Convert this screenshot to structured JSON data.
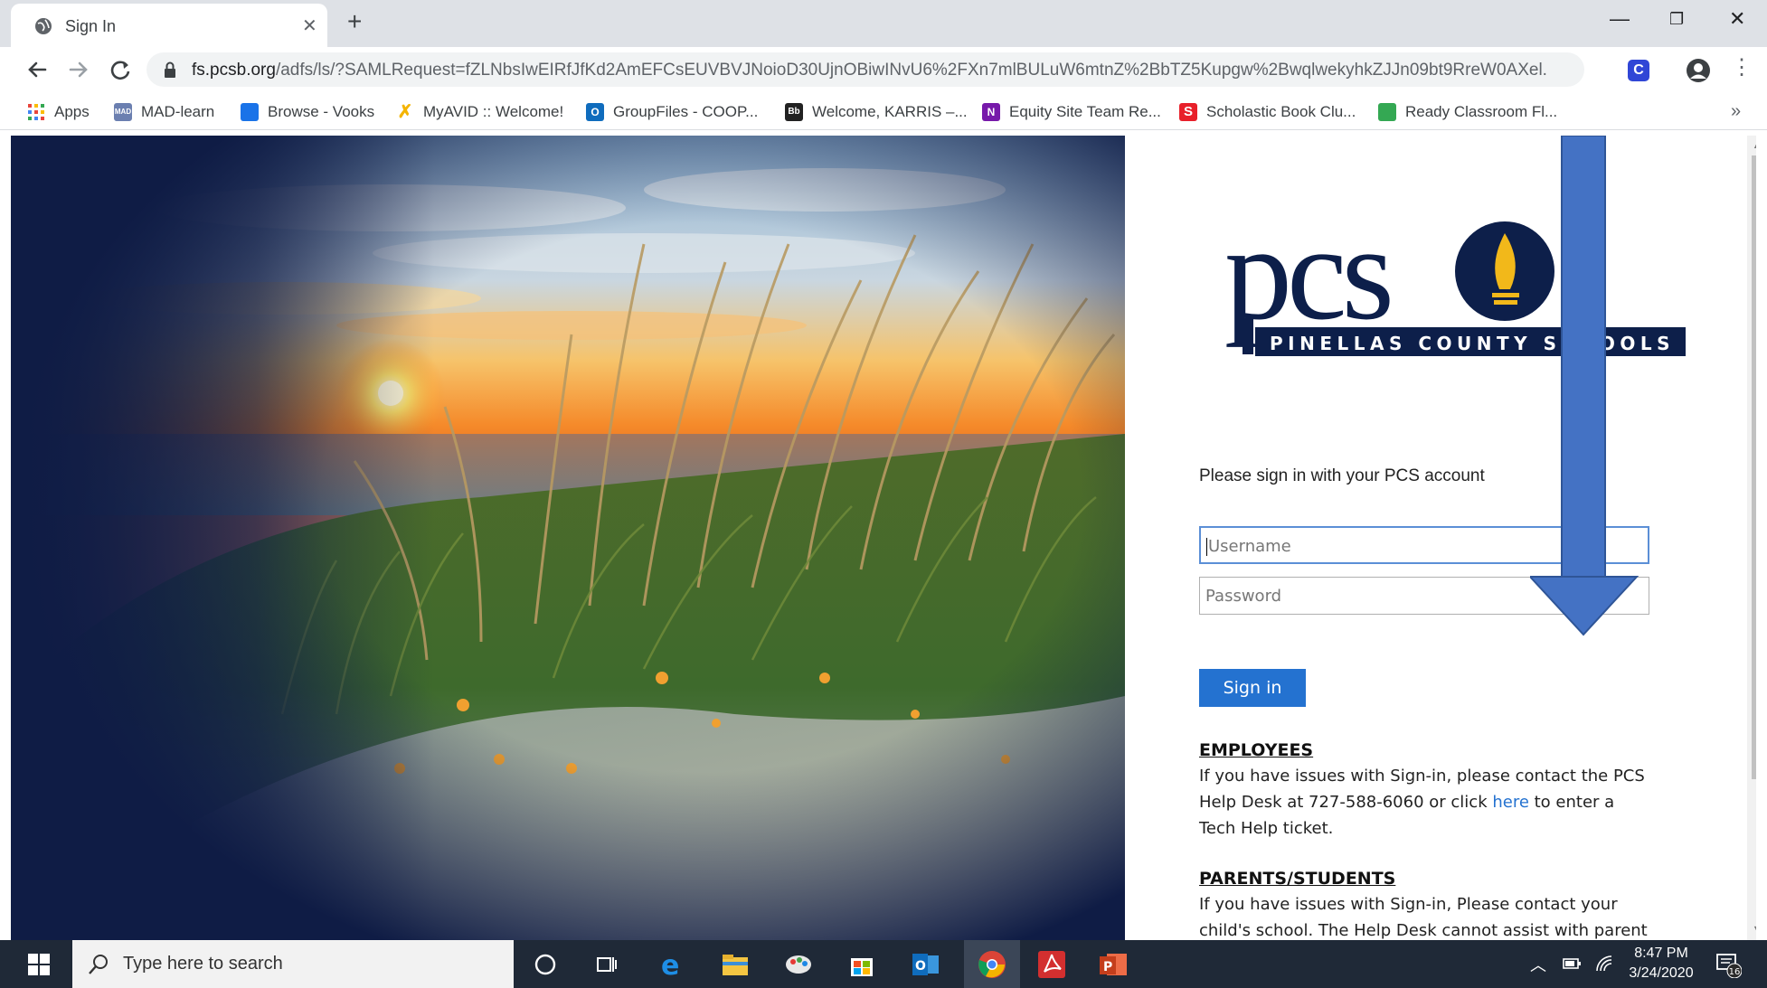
{
  "browser": {
    "tab_title": "Sign In",
    "url_host": "fs.pcsb.org",
    "url_rest": "/adfs/ls/?SAMLRequest=fZLNbsIwEIRfJfKd2AmEFCsEUVBVJNoioD30UjnOBiwINvU6%2FXn7mlBULuW6mtnZ%2BbTZ5Kupgw%2BwqlwekyhkZJJn09bt9RreW0AXel...",
    "bookmarks": [
      {
        "label": "Apps",
        "icon": "apps-grid-icon",
        "color": "#e8453c"
      },
      {
        "label": "MAD-learn",
        "icon": "mad-learn-icon",
        "color": "#6b7fb0"
      },
      {
        "label": "Browse - Vooks",
        "icon": "vooks-icon",
        "color": "#1a73e8"
      },
      {
        "label": "MyAVID :: Welcome!",
        "icon": "avid-icon",
        "color": "#f4b400"
      },
      {
        "label": "GroupFiles - COOP...",
        "icon": "outlook-icon",
        "color": "#0f6cbd"
      },
      {
        "label": "Welcome, KARRIS –...",
        "icon": "blackboard-icon",
        "color": "#222222"
      },
      {
        "label": "Equity Site Team Re...",
        "icon": "onenote-icon",
        "color": "#7719aa"
      },
      {
        "label": "Scholastic Book Clu...",
        "icon": "scholastic-icon",
        "color": "#e8202a"
      },
      {
        "label": "Ready Classroom Fl...",
        "icon": "ready-classroom-icon",
        "color": "#34a853"
      }
    ]
  },
  "signin": {
    "logo_text_main": "pcs",
    "logo_text_sub": "PINELLAS COUNTY SCHOOLS",
    "prompt": "Please sign in with your PCS account",
    "username_placeholder": "Username",
    "password_placeholder": "Password",
    "button_label": "Sign in",
    "employees_heading": "EMPLOYEES",
    "employees_text_before": "If you have issues with Sign-in, please contact the PCS Help Desk at 727-588-6060 or click ",
    "employees_link": "here",
    "employees_text_after": " to enter a Tech Help ticket.",
    "parents_heading": "PARENTS/STUDENTS",
    "parents_text": "If you have issues with Sign-in, Please contact your child's school. The Help Desk cannot assist with parent"
  },
  "taskbar": {
    "search_placeholder": "Type here to search",
    "time": "8:47 PM",
    "date": "3/24/2020",
    "notification_count": "16"
  },
  "colors": {
    "brand_navy": "#0d1f4a",
    "brand_gold": "#f2b81a",
    "button_blue": "#2472d0",
    "annotation_arrow": "#4472c4"
  }
}
